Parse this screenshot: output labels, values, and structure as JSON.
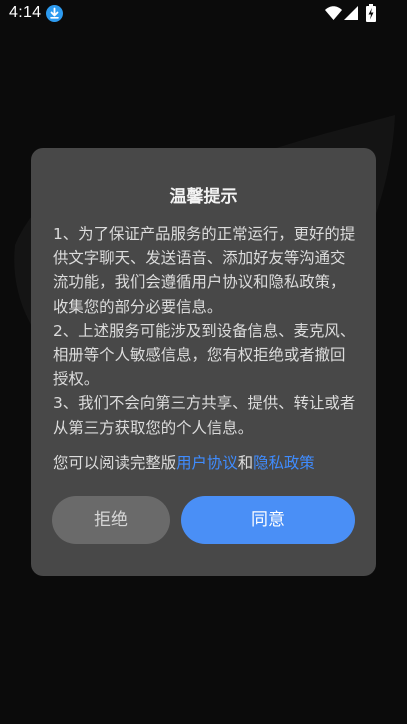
{
  "status_bar": {
    "time": "4:14"
  },
  "dialog": {
    "title": "温馨提示",
    "paragraphs": [
      "1、为了保证产品服务的正常运行，更好的提供文字聊天、发送语音、添加好友等沟通交流功能，我们会遵循用户协议和隐私政策，收集您的部分必要信息。",
      "2、上述服务可能涉及到设备信息、麦克风、相册等个人敏感信息，您有权拒绝或者撤回授权。",
      "3、我们不会向第三方共享、提供、转让或者从第三方获取您的个人信息。"
    ],
    "read_prefix": "您可以阅读完整版",
    "user_agreement_link": "用户协议",
    "conjunction": "和",
    "privacy_policy_link": "隐私政策",
    "reject_label": "拒绝",
    "agree_label": "同意"
  },
  "colors": {
    "dialog_bg": "#484848",
    "link": "#3f8cff",
    "agree_button": "#4a8ff6",
    "reject_button": "#6a6a6a",
    "download_badge": "#2d9bf0"
  }
}
